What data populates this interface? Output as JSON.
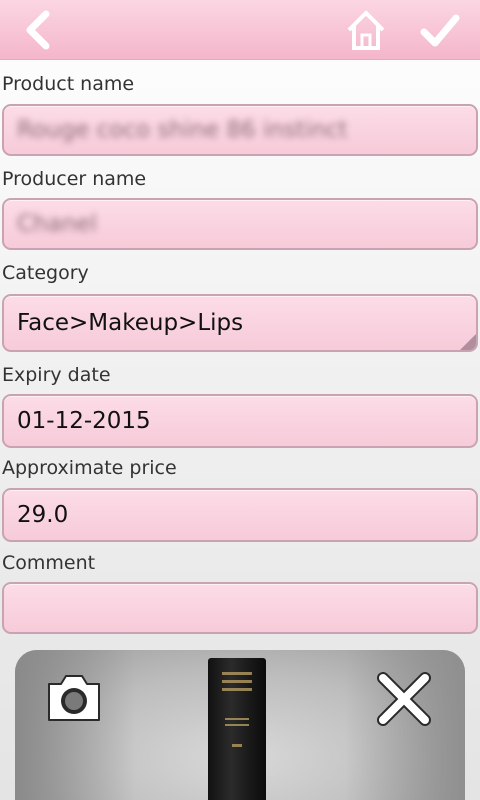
{
  "form": {
    "product_name_label": "Product name",
    "product_name_value": "Rouge coco shine 86 instinct",
    "producer_name_label": "Producer name",
    "producer_name_value": "Chanel",
    "category_label": "Category",
    "category_value": "Face>Makeup>Lips",
    "expiry_date_label": "Expiry date",
    "expiry_date_value": "01-12-2015",
    "price_label": "Approximate price",
    "price_value": "29.0",
    "comment_label": "Comment",
    "comment_value": ""
  },
  "icons": {
    "back": "back-arrow-icon",
    "home": "home-icon",
    "save": "checkmark-icon",
    "camera": "camera-icon",
    "remove_photo": "close-icon"
  },
  "colors": {
    "bar_pink": "#f4b6cb",
    "field_pink": "#f7cbd9",
    "field_border": "#c9a3b1"
  }
}
